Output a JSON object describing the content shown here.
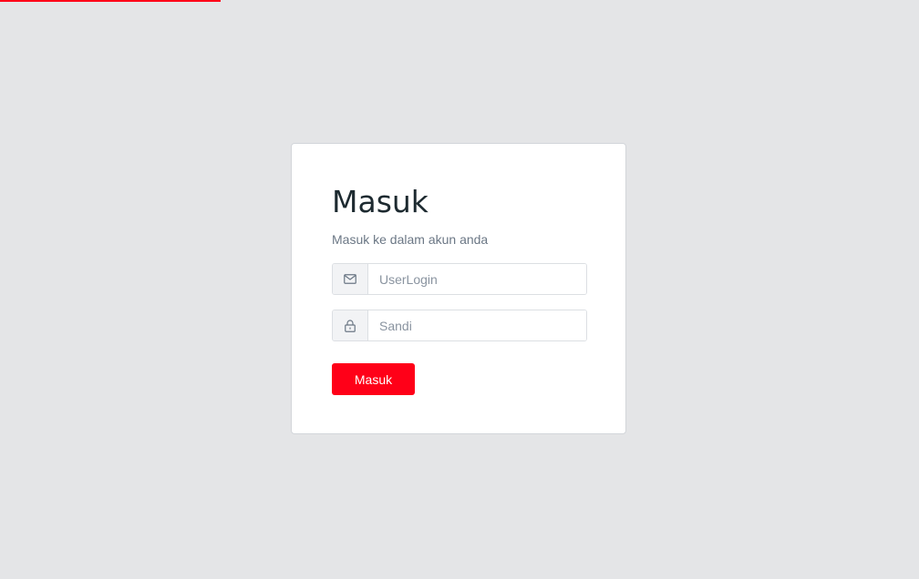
{
  "page": {
    "accent_color": "#ff0018",
    "loading_progress": 0.24
  },
  "login": {
    "title": "Masuk",
    "subtitle": "Masuk ke dalam akun anda",
    "username": {
      "icon": "envelope-icon",
      "placeholder": "UserLogin",
      "value": ""
    },
    "password": {
      "icon": "lock-icon",
      "placeholder": "Sandi",
      "value": ""
    },
    "submit_label": "Masuk"
  }
}
